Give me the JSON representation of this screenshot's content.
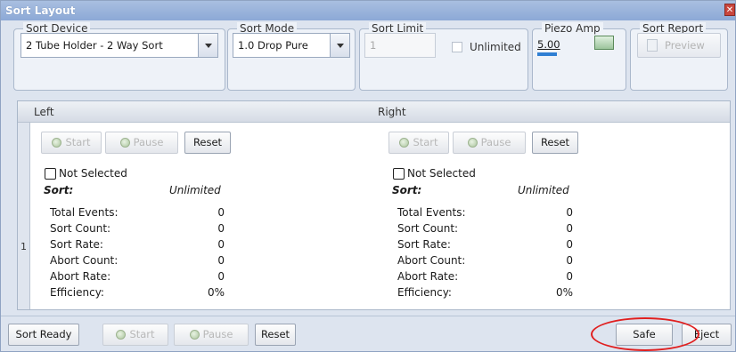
{
  "window": {
    "title": "Sort Layout",
    "close_symbol": "✕"
  },
  "sort_device": {
    "label": "Sort Device",
    "value": "2 Tube Holder - 2 Way Sort"
  },
  "sort_mode": {
    "label": "Sort Mode",
    "value": "1.0 Drop Pure"
  },
  "sort_limit": {
    "label": "Sort Limit",
    "value": "1",
    "unlimited_label": "Unlimited"
  },
  "piezo_amp": {
    "label": "Piezo Amp",
    "value": "5.00"
  },
  "sort_report": {
    "label": "Sort Report",
    "preview_label": "Preview"
  },
  "grid": {
    "row_number": "1",
    "columns": [
      {
        "header": "Left",
        "start_label": "Start",
        "pause_label": "Pause",
        "reset_label": "Reset",
        "not_selected_label": "Not Selected",
        "sort_label": "Sort:",
        "sort_value": "Unlimited",
        "stats": [
          {
            "label": "Total Events:",
            "value": "0"
          },
          {
            "label": "Sort Count:",
            "value": "0"
          },
          {
            "label": "Sort Rate:",
            "value": "0"
          },
          {
            "label": "Abort Count:",
            "value": "0"
          },
          {
            "label": "Abort Rate:",
            "value": "0"
          },
          {
            "label": "Efficiency:",
            "value": "0%"
          }
        ]
      },
      {
        "header": "Right",
        "start_label": "Start",
        "pause_label": "Pause",
        "reset_label": "Reset",
        "not_selected_label": "Not Selected",
        "sort_label": "Sort:",
        "sort_value": "Unlimited",
        "stats": [
          {
            "label": "Total Events:",
            "value": "0"
          },
          {
            "label": "Sort Count:",
            "value": "0"
          },
          {
            "label": "Sort Rate:",
            "value": "0"
          },
          {
            "label": "Abort Count:",
            "value": "0"
          },
          {
            "label": "Abort Rate:",
            "value": "0"
          },
          {
            "label": "Efficiency:",
            "value": "0%"
          }
        ]
      }
    ]
  },
  "bottom": {
    "sort_ready_label": "Sort Ready",
    "start_label": "Start",
    "pause_label": "Pause",
    "reset_label": "Reset",
    "safe_label": "Safe",
    "eject_label": "Eject"
  },
  "colors": {
    "title_bar": "#8ca9d6",
    "highlight_circle": "#e02020",
    "indicator_off": "#a9c49c"
  }
}
